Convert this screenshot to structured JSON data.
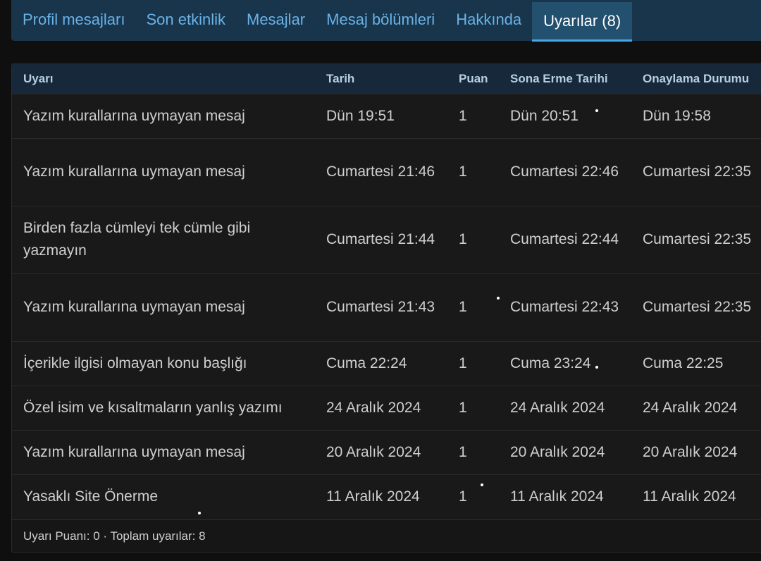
{
  "tabs": [
    {
      "label": "Profil mesajları",
      "active": false
    },
    {
      "label": "Son etkinlik",
      "active": false
    },
    {
      "label": "Mesajlar",
      "active": false
    },
    {
      "label": "Mesaj bölümleri",
      "active": false
    },
    {
      "label": "Hakkında",
      "active": false
    },
    {
      "label": "Uyarılar (8)",
      "active": true
    }
  ],
  "table": {
    "headers": {
      "warning": "Uyarı",
      "date": "Tarih",
      "points": "Puan",
      "expiry": "Sona Erme Tarihi",
      "approval": "Onaylama Durumu"
    },
    "rows": [
      {
        "warning": "Yazım kurallarına uymayan mesaj",
        "date": "Dün 19:51",
        "points": "1",
        "expiry": "Dün 20:51",
        "approval": "Dün 19:58"
      },
      {
        "warning": "Yazım kurallarına uymayan mesaj",
        "date": "Cumartesi 21:46",
        "points": "1",
        "expiry": "Cumartesi 22:46",
        "approval": "Cumartesi 22:35"
      },
      {
        "warning": "Birden fazla cümleyi tek cümle gibi yazmayın",
        "date": "Cumartesi 21:44",
        "points": "1",
        "expiry": "Cumartesi 22:44",
        "approval": "Cumartesi 22:35"
      },
      {
        "warning": "Yazım kurallarına uymayan mesaj",
        "date": "Cumartesi 21:43",
        "points": "1",
        "expiry": "Cumartesi 22:43",
        "approval": "Cumartesi 22:35"
      },
      {
        "warning": "İçerikle ilgisi olmayan konu başlığı",
        "date": "Cuma 22:24",
        "points": "1",
        "expiry": "Cuma 23:24",
        "approval": "Cuma 22:25"
      },
      {
        "warning": "Özel isim ve kısaltmaların yanlış yazımı",
        "date": "24 Aralık 2024",
        "points": "1",
        "expiry": "24 Aralık 2024",
        "approval": "24 Aralık 2024"
      },
      {
        "warning": "Yazım kurallarına uymayan mesaj",
        "date": "20 Aralık 2024",
        "points": "1",
        "expiry": "20 Aralık 2024",
        "approval": "20 Aralık 2024"
      },
      {
        "warning": "Yasaklı Site Önerme",
        "date": "11 Aralık 2024",
        "points": "1",
        "expiry": "11 Aralık 2024",
        "approval": "11 Aralık 2024"
      }
    ]
  },
  "footer": {
    "summary": "Uyarı Puanı: 0 · Toplam uyarılar: 8"
  },
  "colors": {
    "tab_bar": "#18354c",
    "tab_active": "#23506f",
    "tab_text": "#6ab2e6",
    "accent": "#47a7eb",
    "header_row": "#16283a",
    "panel": "#191919",
    "background": "#0f0f10"
  }
}
